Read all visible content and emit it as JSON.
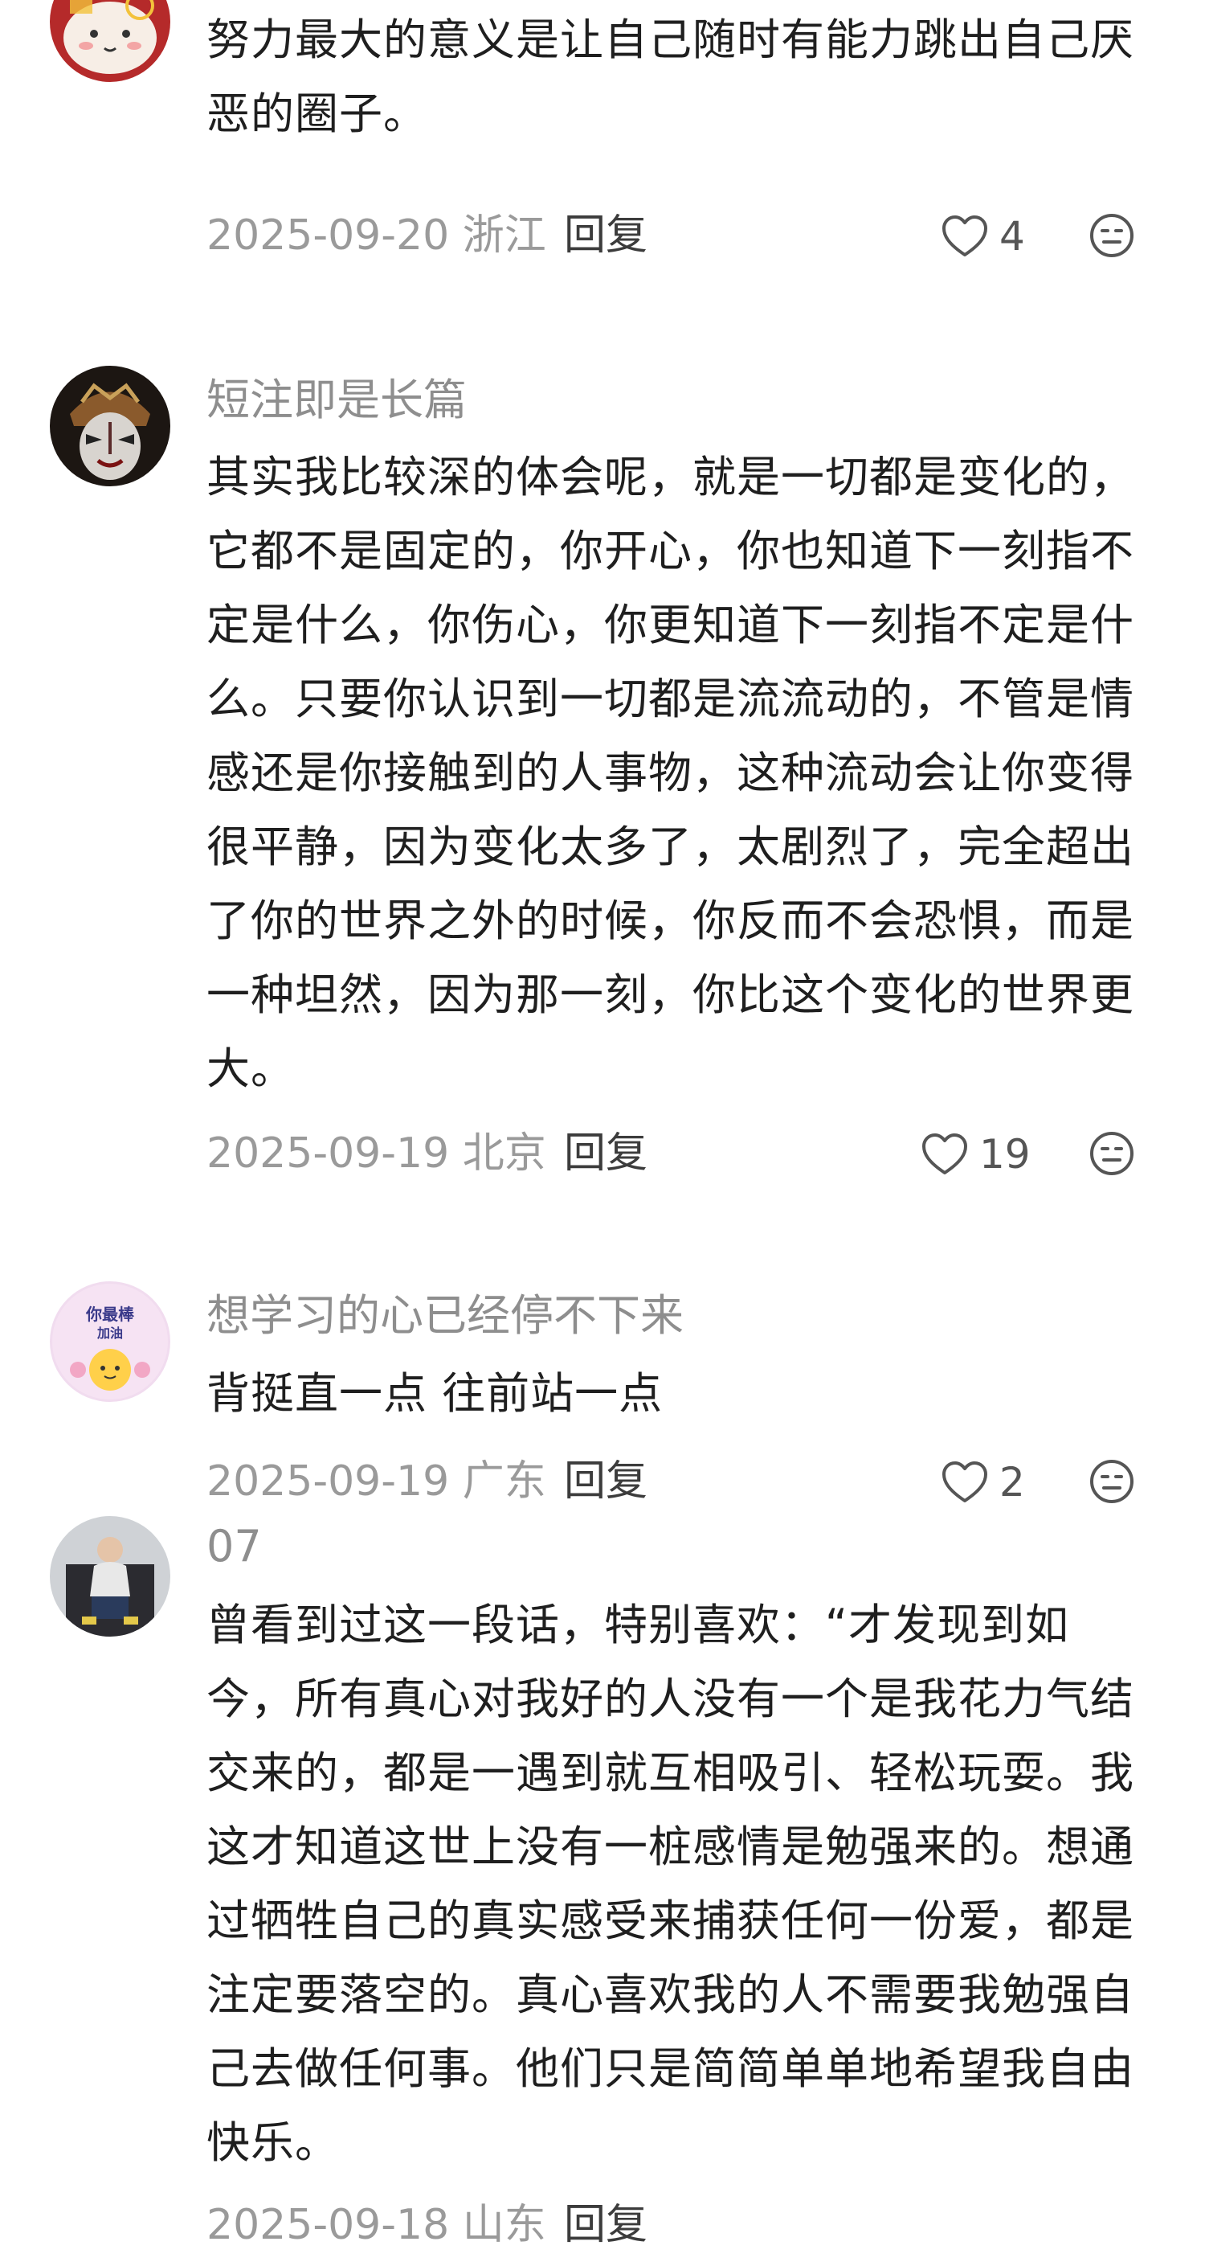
{
  "comments": [
    {
      "username": "",
      "text": "努力最大的意义是让自己随时有能力跳出自己厌恶的圈子。",
      "date_location": "2025-09-20 浙江",
      "reply_label": "回复",
      "like_count": "4"
    },
    {
      "username": "短注即是长篇",
      "text": "其实我比较深的体会呢，就是一切都是变化的，它都不是固定的，你开心，你也知道下一刻指不定是什么，你伤心，你更知道下一刻指不定是什么。只要你认识到一切都是流流动的，不管是情感还是你接触到的人事物，这种流动会让你变得很平静，因为变化太多了，太剧烈了，完全超出了你的世界之外的时候，你反而不会恐惧，而是一种坦然，因为那一刻，你比这个变化的世界更大。",
      "date_location": "2025-09-19 北京",
      "reply_label": "回复",
      "like_count": "19"
    },
    {
      "username": "想学习的心已经停不下来",
      "text": "背挺直一点 往前站一点",
      "date_location": "2025-09-19 广东",
      "reply_label": "回复",
      "like_count": "2",
      "avatar_text": "你最棒 加油"
    },
    {
      "username": "07",
      "text": "曾看到过这一段话，特别喜欢：“才发现到如今，所有真心对我好的人没有一个是我花力气结交来的，都是一遇到就互相吸引、轻松玩耍。我这才知道这世上没有一桩感情是勉强来的。想通过牺牲自己的真实感受来捕获任何一份爱，都是注定要落空的。真心喜欢我的人不需要我勉强自己去做任何事。他们只是简简单单地希望我自由快乐。",
      "date_location": "2025-09-18 山东",
      "reply_label": "回复",
      "like_count": ""
    }
  ],
  "icons": {
    "like": "heart-outline-icon",
    "emoji": "face-emoji-icon"
  },
  "colors": {
    "text": "#1f1f1f",
    "username": "#8e8e8e",
    "meta": "#9a9a9a",
    "icon": "#555555"
  }
}
